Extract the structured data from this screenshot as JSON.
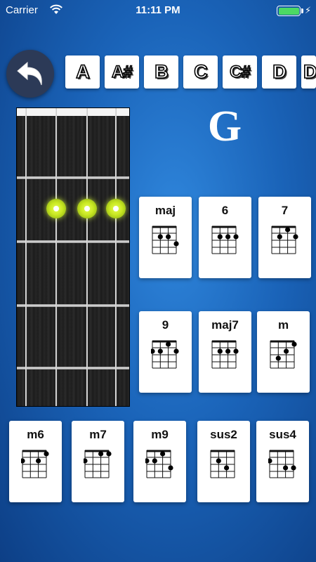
{
  "status_bar": {
    "carrier": "Carrier",
    "time": "11:11 PM",
    "battery_level": 1.0
  },
  "back_button": {
    "icon": "back-arrow-icon"
  },
  "note_tabs": [
    "A",
    "A#",
    "B",
    "C",
    "C#",
    "D",
    "D"
  ],
  "current_chord": "G",
  "fretboard": {
    "strings": 4,
    "frets_visible": 5,
    "dots": [
      {
        "string": 2,
        "fret": 2
      },
      {
        "string": 3,
        "fret": 2
      },
      {
        "string": 4,
        "fret": 2
      }
    ]
  },
  "chord_cards": [
    {
      "label": "maj",
      "dots": [
        [
          2,
          2
        ],
        [
          3,
          2
        ],
        [
          4,
          3
        ]
      ]
    },
    {
      "label": "6",
      "dots": [
        [
          2,
          2
        ],
        [
          3,
          2
        ],
        [
          4,
          2
        ]
      ]
    },
    {
      "label": "7",
      "dots": [
        [
          2,
          2
        ],
        [
          3,
          1
        ],
        [
          4,
          2
        ]
      ]
    },
    {
      "label": "9",
      "dots": [
        [
          1,
          2
        ],
        [
          2,
          2
        ],
        [
          3,
          1
        ],
        [
          4,
          2
        ]
      ]
    },
    {
      "label": "maj7",
      "dots": [
        [
          2,
          2
        ],
        [
          3,
          2
        ],
        [
          4,
          2
        ]
      ]
    },
    {
      "label": "m",
      "dots": [
        [
          2,
          3
        ],
        [
          3,
          2
        ],
        [
          4,
          1
        ]
      ]
    },
    {
      "label": "m6",
      "dots": [
        [
          1,
          2
        ],
        [
          3,
          2
        ],
        [
          4,
          1
        ]
      ]
    },
    {
      "label": "m7",
      "dots": [
        [
          1,
          2
        ],
        [
          3,
          1
        ],
        [
          4,
          1
        ]
      ]
    },
    {
      "label": "m9",
      "dots": [
        [
          1,
          2
        ],
        [
          2,
          2
        ],
        [
          3,
          1
        ],
        [
          4,
          3
        ]
      ]
    },
    {
      "label": "sus2",
      "dots": [
        [
          2,
          2
        ],
        [
          3,
          3
        ]
      ]
    },
    {
      "label": "sus4",
      "dots": [
        [
          1,
          2
        ],
        [
          3,
          3
        ],
        [
          4,
          3
        ]
      ]
    }
  ],
  "colors": {
    "background": "#1a63b8",
    "dot": "#d8f53a",
    "card": "#ffffff",
    "back_button": "#2c3a57"
  }
}
